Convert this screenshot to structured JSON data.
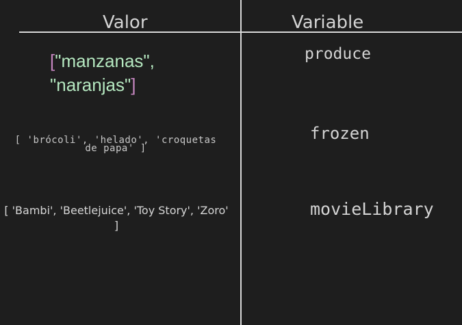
{
  "table": {
    "headers": {
      "value": "Valor",
      "variable": "Variable"
    },
    "rows": [
      {
        "value_parts": {
          "open": "[",
          "item1": "\"manzanas\",",
          "item2": "\"naranjas\"",
          "close": "]"
        },
        "variable": "produce"
      },
      {
        "value_line1": "[ 'brócoli', 'helado', 'croquetas",
        "value_line2": "de papa' ]",
        "variable": "frozen"
      },
      {
        "value_line1": "[ 'Bambi', 'Beetlejuice', 'Toy Story', 'Zoro'",
        "value_line2": "]",
        "variable": "movieLibrary"
      }
    ]
  },
  "colors": {
    "background": "#1e1e1e",
    "grid_lines": "#d9d9d9",
    "string_green": "#b5e8c0",
    "bracket_purple": "#c586c0",
    "text": "#d4d4d4"
  }
}
